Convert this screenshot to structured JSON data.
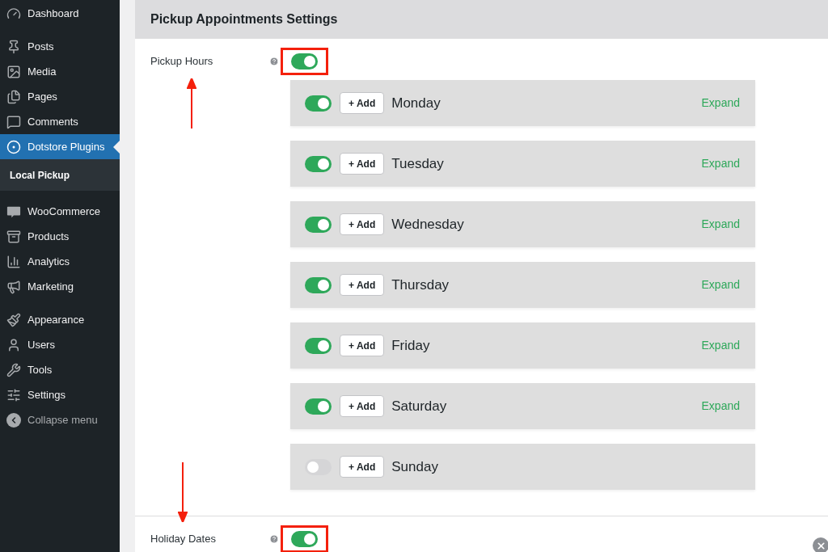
{
  "sidebar": {
    "groups": [
      {
        "items": [
          {
            "label": "Dashboard",
            "selected": false,
            "muted": false
          }
        ]
      },
      {
        "items": [
          {
            "label": "Posts",
            "selected": false,
            "muted": false
          },
          {
            "label": "Media",
            "selected": false,
            "muted": false
          },
          {
            "label": "Pages",
            "selected": false,
            "muted": false
          },
          {
            "label": "Comments",
            "selected": false,
            "muted": false
          },
          {
            "label": "Dotstore Plugins",
            "selected": true,
            "muted": false,
            "children": [
              {
                "label": "Local Pickup",
                "selected": true
              }
            ]
          }
        ]
      },
      {
        "items": [
          {
            "label": "WooCommerce",
            "selected": false,
            "muted": false
          },
          {
            "label": "Products",
            "selected": false,
            "muted": false
          },
          {
            "label": "Analytics",
            "selected": false,
            "muted": false
          },
          {
            "label": "Marketing",
            "selected": false,
            "muted": false
          }
        ]
      },
      {
        "items": [
          {
            "label": "Appearance",
            "selected": false,
            "muted": false
          },
          {
            "label": "Users",
            "selected": false,
            "muted": false
          },
          {
            "label": "Tools",
            "selected": false,
            "muted": false
          },
          {
            "label": "Settings",
            "selected": false,
            "muted": false
          },
          {
            "label": "Collapse menu",
            "selected": false,
            "muted": true
          }
        ]
      }
    ]
  },
  "panel": {
    "title": "Pickup Appointments Settings",
    "settings": [
      {
        "label": "Pickup Hours",
        "on": true,
        "highlighted": true,
        "days": [
          {
            "label": "Monday",
            "on": true,
            "button": "+ Add",
            "link": "Expand"
          },
          {
            "label": "Tuesday",
            "on": true,
            "button": "+ Add",
            "link": "Expand"
          },
          {
            "label": "Wednesday",
            "on": true,
            "button": "+ Add",
            "link": "Expand"
          },
          {
            "label": "Thursday",
            "on": true,
            "button": "+ Add",
            "link": "Expand"
          },
          {
            "label": "Friday",
            "on": true,
            "button": "+ Add",
            "link": "Expand"
          },
          {
            "label": "Saturday",
            "on": true,
            "button": "+ Add",
            "link": "Expand"
          },
          {
            "label": "Sunday",
            "on": false,
            "button": "+ Add"
          }
        ]
      },
      {
        "label": "Holiday Dates",
        "on": true,
        "highlighted": true
      }
    ]
  }
}
